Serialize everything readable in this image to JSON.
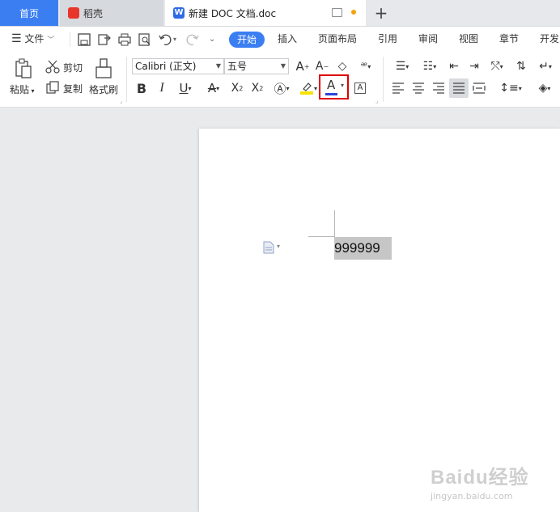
{
  "tabs": {
    "home": "首页",
    "daoke": "稻壳",
    "doc": "新建 DOC 文档.doc",
    "add": "+"
  },
  "menubar": {
    "file": "文件",
    "tabs": [
      "开始",
      "插入",
      "页面布局",
      "引用",
      "审阅",
      "视图",
      "章节",
      "开发"
    ]
  },
  "ribbon": {
    "paste": "粘贴",
    "cut": "剪切",
    "copy": "复制",
    "format_painter": "格式刷",
    "font_name": "Calibri (正文)",
    "font_size": "五号",
    "font_color_accent": "#2b46d9",
    "highlight_color": "#f6e300",
    "callout_color": "#e00000"
  },
  "document": {
    "text": "999999"
  },
  "watermark": {
    "brand": "Baidu经验",
    "url": "jingyan.baidu.com"
  }
}
